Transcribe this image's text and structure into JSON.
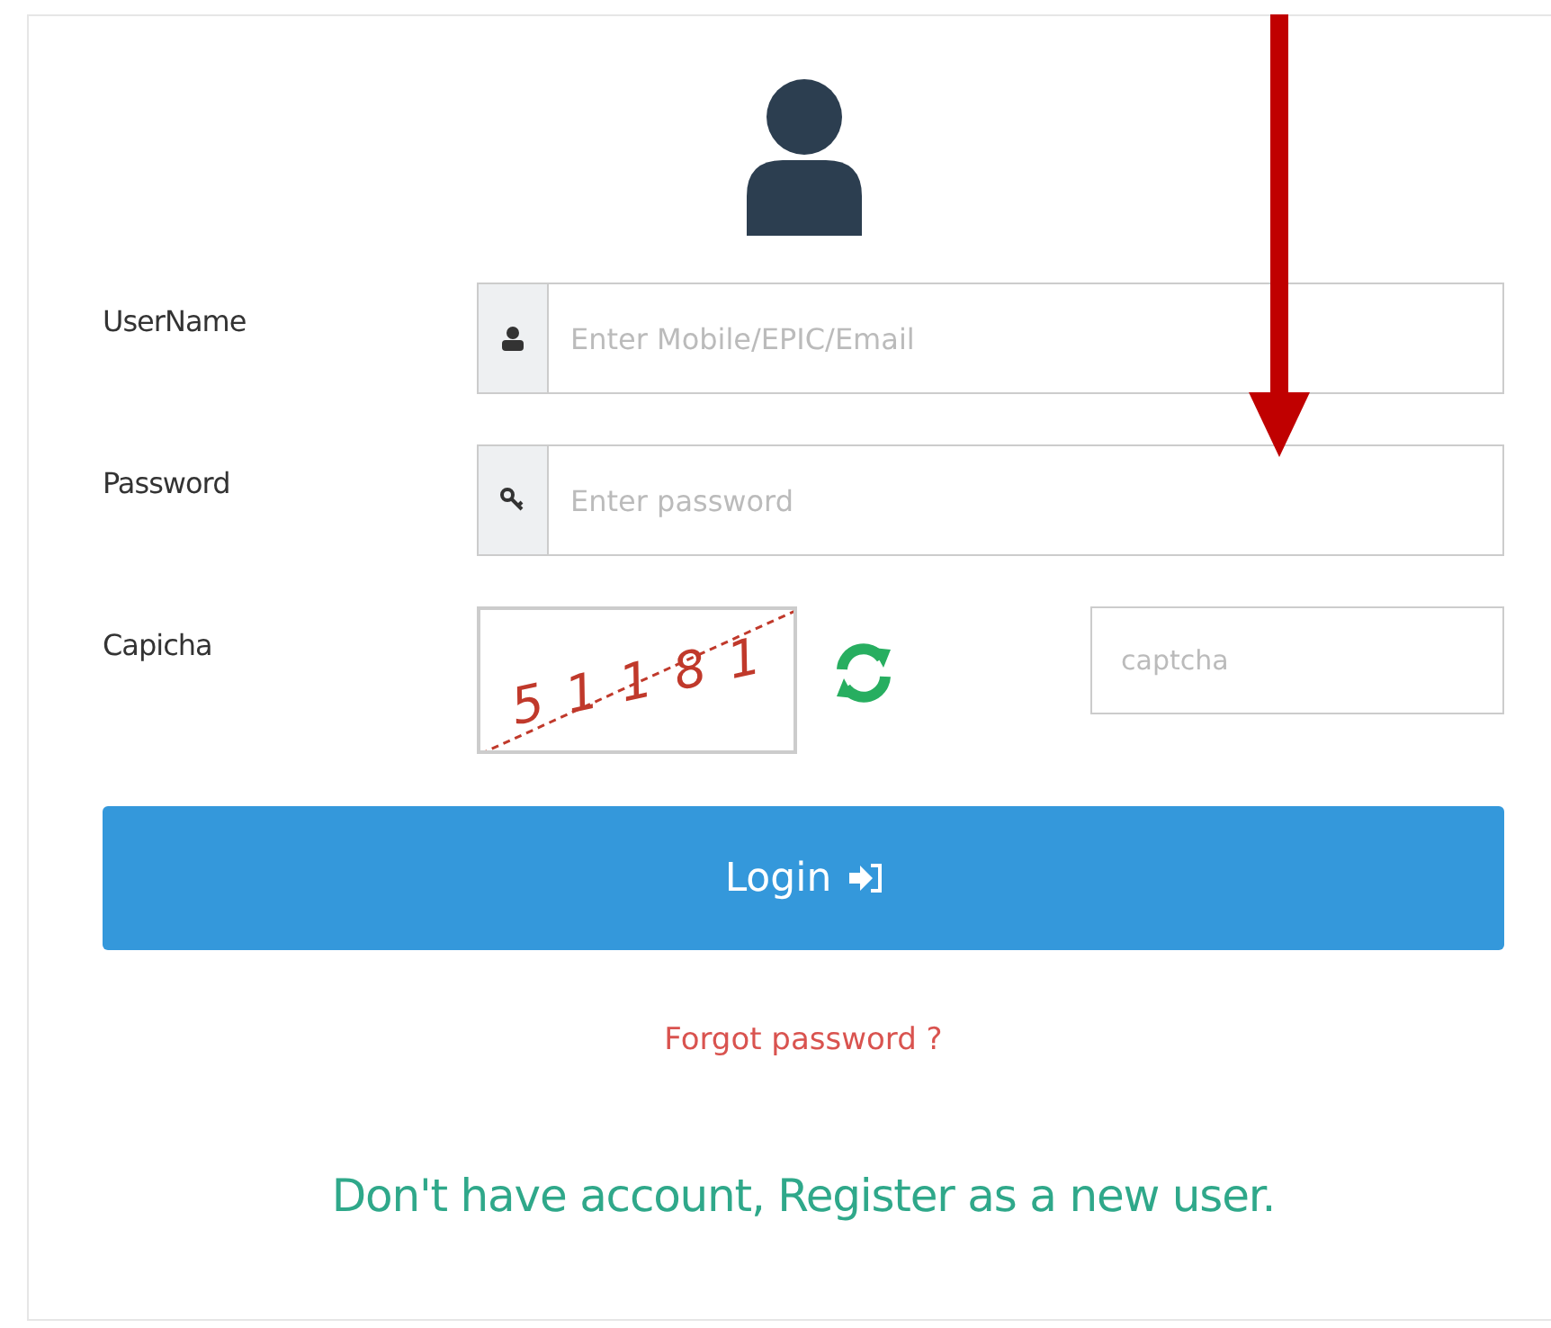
{
  "form": {
    "fields": [
      {
        "kind": "user",
        "label": "UserName",
        "placeholder": "Enter Mobile/EPIC/Email"
      },
      {
        "kind": "key",
        "label": "Password",
        "placeholder": "Enter password"
      }
    ],
    "captcha": {
      "label": "Capicha",
      "code": "5 1 1 8 1",
      "placeholder": "captcha"
    },
    "login_button": "Login",
    "forgot_link": "Forgot password ?",
    "register_link": "Don't have account, Register as a new user."
  }
}
